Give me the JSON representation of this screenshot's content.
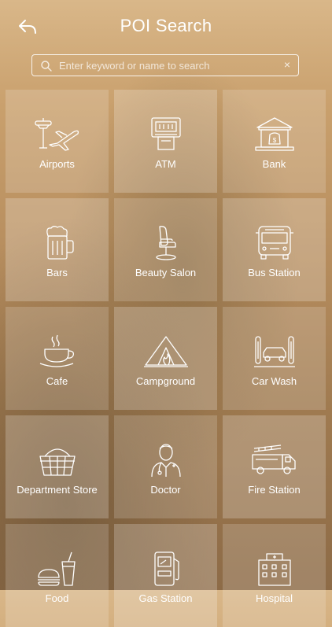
{
  "header": {
    "title": "POI Search",
    "back_icon": "back-arrow-icon"
  },
  "search": {
    "placeholder": "Enter keyword or name to search",
    "value": "",
    "clear_label": "×"
  },
  "categories": [
    {
      "label": "Airports",
      "icon": "airport-icon"
    },
    {
      "label": "ATM",
      "icon": "atm-icon"
    },
    {
      "label": "Bank",
      "icon": "bank-icon"
    },
    {
      "label": "Bars",
      "icon": "beer-mug-icon"
    },
    {
      "label": "Beauty Salon",
      "icon": "salon-chair-icon"
    },
    {
      "label": "Bus Station",
      "icon": "bus-icon"
    },
    {
      "label": "Cafe",
      "icon": "coffee-cup-icon"
    },
    {
      "label": "Campground",
      "icon": "tent-icon"
    },
    {
      "label": "Car Wash",
      "icon": "car-wash-icon"
    },
    {
      "label": "Department Store",
      "icon": "shopping-basket-icon"
    },
    {
      "label": "Doctor",
      "icon": "doctor-icon"
    },
    {
      "label": "Fire Station",
      "icon": "fire-truck-icon"
    },
    {
      "label": "Food",
      "icon": "food-icon"
    },
    {
      "label": "Gas Station",
      "icon": "gas-pump-icon"
    },
    {
      "label": "Hospital",
      "icon": "hospital-icon"
    }
  ]
}
